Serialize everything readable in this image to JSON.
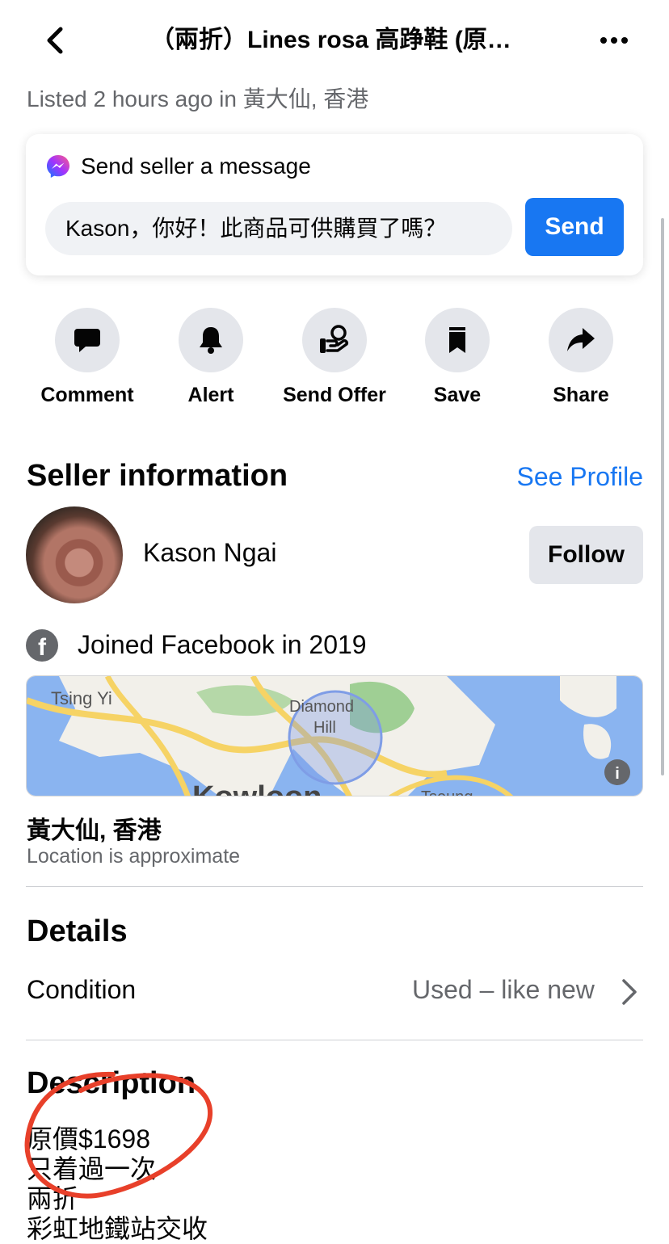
{
  "header": {
    "title": "（兩折）Lines rosa 高踭鞋 (原…",
    "listed": "Listed 2 hours ago in 黃大仙, 香港"
  },
  "message": {
    "title": "Send seller a message",
    "input_value": "Kason，你好！此商品可供購買了嗎？",
    "send_label": "Send"
  },
  "actions": [
    {
      "label": "Comment",
      "icon": "comment-icon"
    },
    {
      "label": "Alert",
      "icon": "bell-icon"
    },
    {
      "label": "Send Offer",
      "icon": "offer-icon"
    },
    {
      "label": "Save",
      "icon": "bookmark-icon"
    },
    {
      "label": "Share",
      "icon": "share-icon"
    }
  ],
  "seller": {
    "heading": "Seller information",
    "see_profile": "See Profile",
    "name": "Kason Ngai",
    "follow_label": "Follow",
    "joined": "Joined Facebook in 2019"
  },
  "map": {
    "labels": [
      "Tsing Yi",
      "Diamond",
      "Hill",
      "Kowloon",
      "Tseung"
    ],
    "info_icon": "i"
  },
  "location": {
    "name": "黃大仙, 香港",
    "note": "Location is approximate"
  },
  "details": {
    "heading": "Details",
    "condition_label": "Condition",
    "condition_value": "Used – like new"
  },
  "description": {
    "heading": "Description",
    "lines": [
      "原價$1698",
      "只着過一次",
      "兩折",
      "彩虹地鐵站交收"
    ]
  },
  "colors": {
    "accent": "#1877f2",
    "annotation": "#e8402a"
  }
}
